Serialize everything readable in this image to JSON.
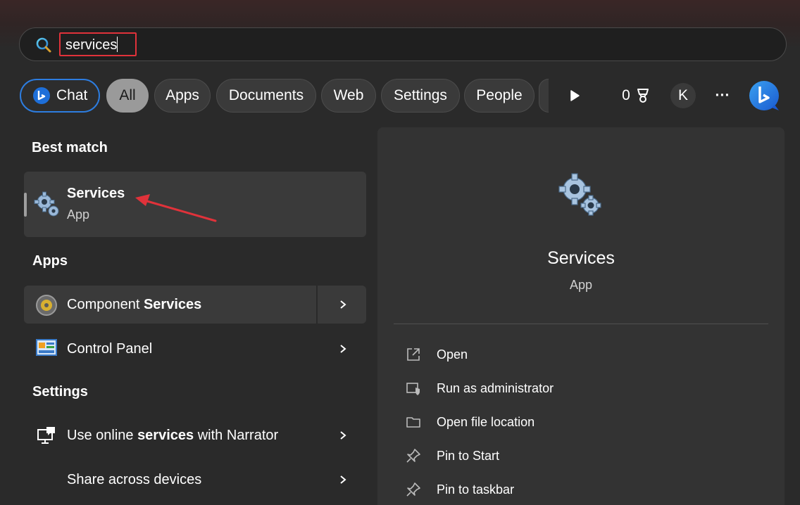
{
  "search": {
    "value": "services"
  },
  "filters": {
    "chat": "Chat",
    "all": "All",
    "apps": "Apps",
    "documents": "Documents",
    "web": "Web",
    "settings": "Settings",
    "people": "People",
    "points": "0",
    "account_initial": "K",
    "more": "···"
  },
  "left": {
    "best_match_header": "Best match",
    "best_match": {
      "title": "Services",
      "subtitle": "App"
    },
    "apps_header": "Apps",
    "apps": [
      {
        "label_pre": "Component ",
        "label_bold": "Services"
      },
      {
        "label_pre": "Control Panel",
        "label_bold": ""
      }
    ],
    "settings_header": "Settings",
    "settings": [
      {
        "label_pre": "Use online ",
        "label_bold": "services",
        "label_post": " with Narrator"
      },
      {
        "label_pre": "Share across devices"
      }
    ]
  },
  "detail": {
    "title": "Services",
    "subtitle": "App",
    "actions": [
      "Open",
      "Run as administrator",
      "Open file location",
      "Pin to Start",
      "Pin to taskbar"
    ]
  },
  "colors": {
    "accent": "#2d7de0",
    "highlight_box": "#e0323a",
    "annotation_arrow": "#e0323a"
  }
}
